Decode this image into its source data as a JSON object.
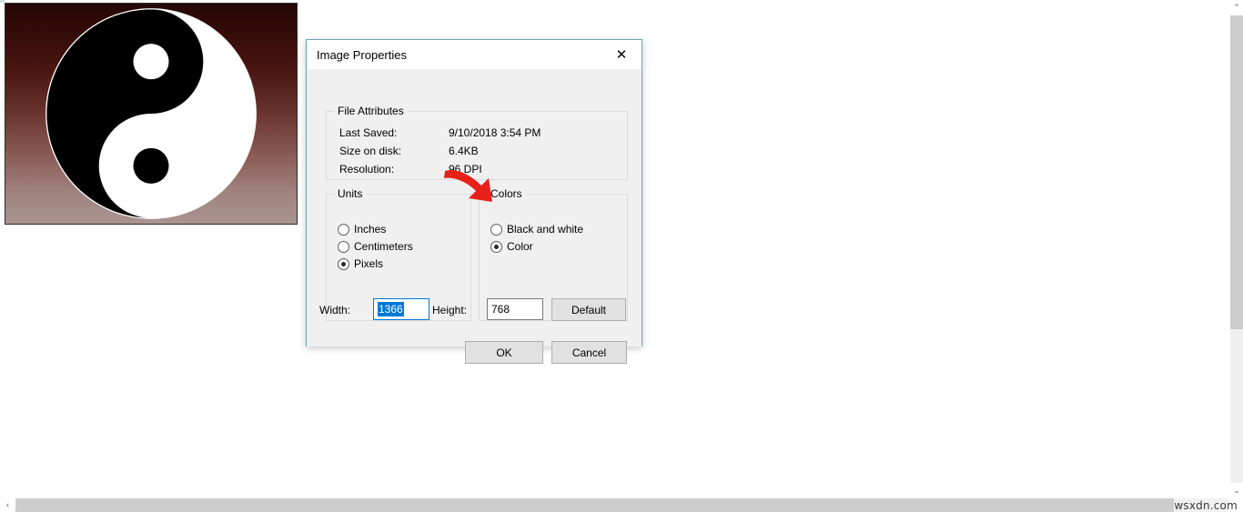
{
  "app": {
    "canvas_image_name": "yin-yang-symbol",
    "background_gradient_top": "#250706",
    "background_gradient_bottom": "#a89490",
    "watermark": "wsxdn.com"
  },
  "scrollbars": {
    "vertical_up_arrow": "⌃",
    "vertical_down_arrow": "⌄",
    "horizontal_left_arrow": "‹"
  },
  "dialog": {
    "title": "Image Properties",
    "close_label": "✕",
    "file_attributes": {
      "legend": "File Attributes",
      "rows": [
        {
          "key": "Last Saved:",
          "value": "9/10/2018 3:54 PM"
        },
        {
          "key": "Size on disk:",
          "value": "6.4KB"
        },
        {
          "key": "Resolution:",
          "value": "96 DPI"
        }
      ]
    },
    "units": {
      "legend": "Units",
      "options": [
        {
          "label": "Inches",
          "checked": false
        },
        {
          "label": "Centimeters",
          "checked": false
        },
        {
          "label": "Pixels",
          "checked": true
        }
      ]
    },
    "colors": {
      "legend": "Colors",
      "options": [
        {
          "label": "Black and white",
          "checked": false
        },
        {
          "label": "Color",
          "checked": true
        }
      ]
    },
    "dimensions": {
      "width_label": "Width:",
      "width_value": "1366",
      "width_selected": true,
      "height_label": "Height:",
      "height_value": "768",
      "default_button": "Default"
    },
    "buttons": {
      "ok": "OK",
      "cancel": "Cancel"
    },
    "border_color": "#6ba5b8",
    "selection_color": "#0078d7"
  },
  "annotation": {
    "arrow_color": "#e8201a",
    "points_to": "Black and white"
  }
}
